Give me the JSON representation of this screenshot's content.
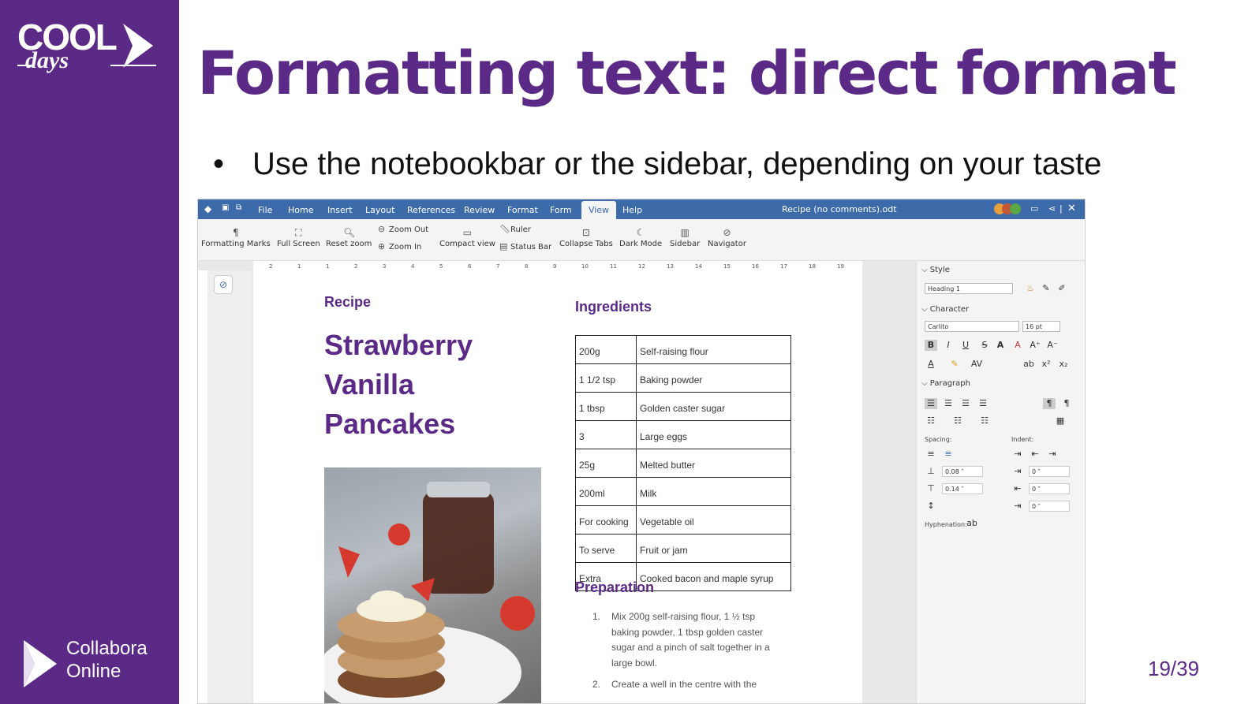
{
  "slide": {
    "title": "Formatting text: direct format",
    "bullet": "Use the notebookbar or the sidebar, depending on your taste",
    "bullet_mark": "•",
    "page_number": "19/39",
    "brand_color": "#5b2a86"
  },
  "logos": {
    "cool": "COOL",
    "days": "days",
    "collabora_line1": "Collabora",
    "collabora_line2": "Online"
  },
  "app": {
    "menu": [
      "File",
      "Home",
      "Insert",
      "Layout",
      "References",
      "Review",
      "Format",
      "Form",
      "View",
      "Help"
    ],
    "active_tab": "View",
    "doc_title": "Recipe (no comments).odt",
    "ribbon": {
      "formatting_marks": "Formatting Marks",
      "full_screen": "Full Screen",
      "reset_zoom": "Reset zoom",
      "zoom_out": "Zoom Out",
      "zoom_in": "Zoom In",
      "compact_view": "Compact view",
      "ruler": "Ruler",
      "status_bar": "Status Bar",
      "collapse_tabs": "Collapse Tabs",
      "dark_mode": "Dark Mode",
      "sidebar": "Sidebar",
      "navigator": "Navigator"
    },
    "ruler_ticks": [
      "2",
      "1",
      "1",
      "2",
      "3",
      "4",
      "5",
      "6",
      "7",
      "8",
      "9",
      "10",
      "11",
      "12",
      "13",
      "14",
      "15",
      "16",
      "17",
      "18",
      "19"
    ],
    "document": {
      "recipe_label": "Recipe",
      "dish_title": "Strawberry Vanilla Pancakes",
      "ingredients_heading": "Ingredients",
      "ingredients": [
        [
          "200g",
          "Self-raising flour"
        ],
        [
          "1 1/2 tsp",
          "Baking powder"
        ],
        [
          "1 tbsp",
          "Golden caster sugar"
        ],
        [
          "3",
          "Large eggs"
        ],
        [
          "25g",
          "Melted butter"
        ],
        [
          "200ml",
          "Milk"
        ],
        [
          "For cooking",
          "Vegetable oil"
        ],
        [
          "To serve",
          "Fruit or jam"
        ],
        [
          "Extra",
          "Cooked bacon and maple syrup"
        ]
      ],
      "preparation_heading": "Preparation",
      "steps": [
        {
          "num": "1.",
          "text": "Mix 200g self-raising flour, 1 ½ tsp baking powder, 1 tbsp golden caster sugar and a pinch of salt together in a large bowl."
        },
        {
          "num": "2.",
          "text": "Create a well in the centre with the"
        }
      ]
    },
    "sidebar": {
      "style_heading": "Style",
      "style_value": "Heading 1",
      "character_heading": "Character",
      "font_value": "Carlito",
      "size_value": "16 pt",
      "paragraph_heading": "Paragraph",
      "spacing_label": "Spacing:",
      "indent_label": "Indent:",
      "spacing_above": "0.08 ″",
      "spacing_below": "0.14 ″",
      "indent_before": "0 ″",
      "indent_after": "0 ″",
      "indent_first": "0 ″",
      "hyphenation_label": "Hyphenation:"
    }
  }
}
